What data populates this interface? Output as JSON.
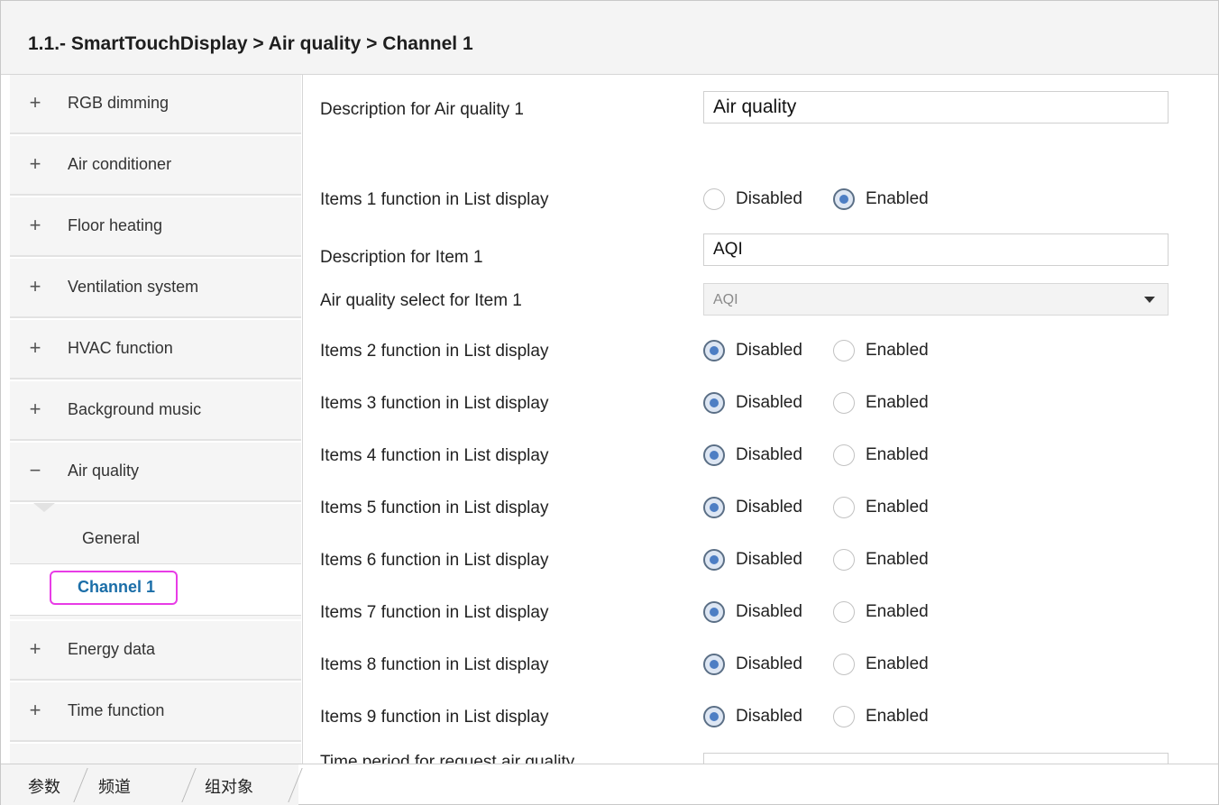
{
  "header": {
    "title": "1.1.- SmartTouchDisplay > Air quality > Channel 1"
  },
  "sidebar": {
    "items_top": [
      {
        "sign": "+",
        "label": "RGB dimming"
      },
      {
        "sign": "+",
        "label": "Air conditioner"
      },
      {
        "sign": "+",
        "label": "Floor heating"
      },
      {
        "sign": "+",
        "label": "Ventilation system"
      },
      {
        "sign": "+",
        "label": "HVAC function"
      },
      {
        "sign": "+",
        "label": "Background music"
      },
      {
        "sign": "−",
        "label": "Air quality"
      }
    ],
    "sub_items": [
      {
        "label": "General"
      },
      {
        "label": "Channel 1"
      }
    ],
    "items_bottom": [
      {
        "sign": "+",
        "label": "Energy data"
      },
      {
        "sign": "+",
        "label": "Time function"
      }
    ]
  },
  "main": {
    "description_row": {
      "label": "Description for Air quality 1",
      "value": "Air quality"
    },
    "items1_row": {
      "label": "Items 1 function in List display",
      "options": [
        "Disabled",
        "Enabled"
      ],
      "selected": "Enabled"
    },
    "item1_desc_row": {
      "label": "Description for Item 1",
      "value": "AQI"
    },
    "item1_select_row": {
      "label": "Air quality select for Item 1",
      "value": "AQI"
    },
    "items_rows": [
      {
        "label": "Items 2 function in List display",
        "options": [
          "Disabled",
          "Enabled"
        ],
        "selected": "Disabled"
      },
      {
        "label": "Items 3 function in List display",
        "options": [
          "Disabled",
          "Enabled"
        ],
        "selected": "Disabled"
      },
      {
        "label": "Items 4 function in List display",
        "options": [
          "Disabled",
          "Enabled"
        ],
        "selected": "Disabled"
      },
      {
        "label": "Items 5 function in List display",
        "options": [
          "Disabled",
          "Enabled"
        ],
        "selected": "Disabled"
      },
      {
        "label": "Items 6 function in List display",
        "options": [
          "Disabled",
          "Enabled"
        ],
        "selected": "Disabled"
      },
      {
        "label": "Items 7 function in List display",
        "options": [
          "Disabled",
          "Enabled"
        ],
        "selected": "Disabled"
      },
      {
        "label": "Items 8 function in List display",
        "options": [
          "Disabled",
          "Enabled"
        ],
        "selected": "Disabled"
      },
      {
        "label": "Items 9 function in List display",
        "options": [
          "Disabled",
          "Enabled"
        ],
        "selected": "Disabled"
      }
    ],
    "time_period_row": {
      "label": "Time period for request air quality"
    }
  },
  "bottom_tabs": [
    "参数",
    "频道",
    "组对象"
  ],
  "colors": {
    "highlight_border": "#e83ce6",
    "active_text": "#1b6ea8",
    "radio_fill": "#4d7ec4"
  }
}
